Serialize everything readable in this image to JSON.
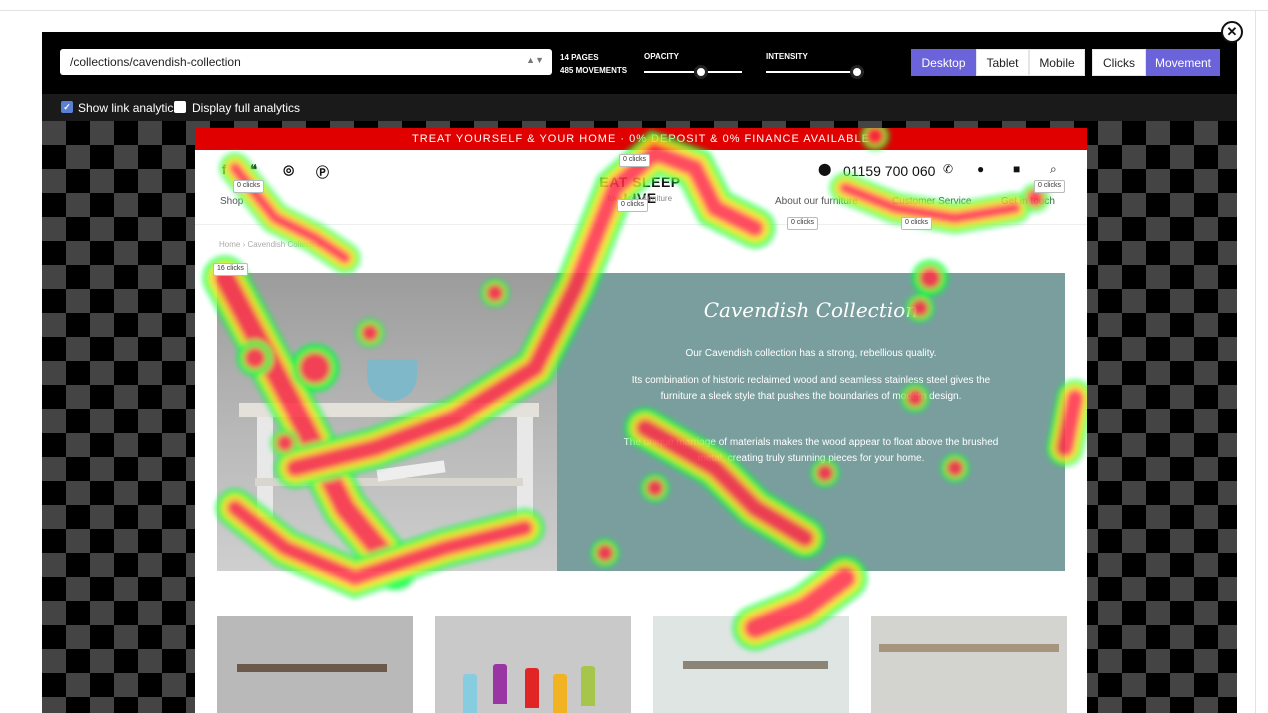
{
  "toolbar": {
    "page_path": "/collections/cavendish-collection",
    "pages": "14 PAGES",
    "movements": "485 MOVEMENTS",
    "opacity_label": "OPACITY",
    "opacity_value": 0.7,
    "intensity_label": "INTENSITY",
    "intensity_value": 0.95,
    "devices": [
      "Desktop",
      "Tablet",
      "Mobile"
    ],
    "device_selected": "Desktop",
    "modes": [
      "Clicks",
      "Movement"
    ],
    "mode_selected": "Movement",
    "close_icon": "close-icon"
  },
  "options": {
    "show_link_analytics": {
      "label": "Show link analytics",
      "checked": true
    },
    "display_full_analytics": {
      "label": "Display full analytics",
      "checked": false
    }
  },
  "site": {
    "promo": "TREAT YOURSELF & YOUR HOME · 0% DEPOSIT & 0% FINANCE AVAILABLE",
    "social_icons": [
      "facebook-icon",
      "twitter-icon",
      "instagram-icon",
      "pinterest-icon"
    ],
    "social_glyphs": [
      "f",
      "❝",
      "◎",
      "Ⓟ"
    ],
    "brand": "EAT SLEEP LIVE",
    "tagline": "love your furniture",
    "phone": "01159 700 060",
    "nav": {
      "shop": "Shop",
      "about": "About our furniture",
      "customer_service": "Customer Service",
      "contact": "Get in touch"
    },
    "breadcrumb": "Home  ›  Cavendish Collection",
    "clicks_labels": {
      "top_center": "0 clicks",
      "tagline": "0 clicks",
      "social": "0 clicks",
      "search": "0 clicks",
      "about": "0 clicks",
      "customer_service": "0 clicks",
      "breadcrumb": "16 clicks"
    },
    "hero": {
      "title": "Cavendish Collection",
      "p1": "Our Cavendish collection has a strong, rebellious quality.",
      "p2": "Its combination of historic reclaimed wood and seamless stainless steel gives the furniture a sleek style that pushes the boundaries of modern design.",
      "p3": "The unique marriage of materials makes the wood appear to float above the brushed metal, creating truly stunning pieces for your home."
    }
  }
}
